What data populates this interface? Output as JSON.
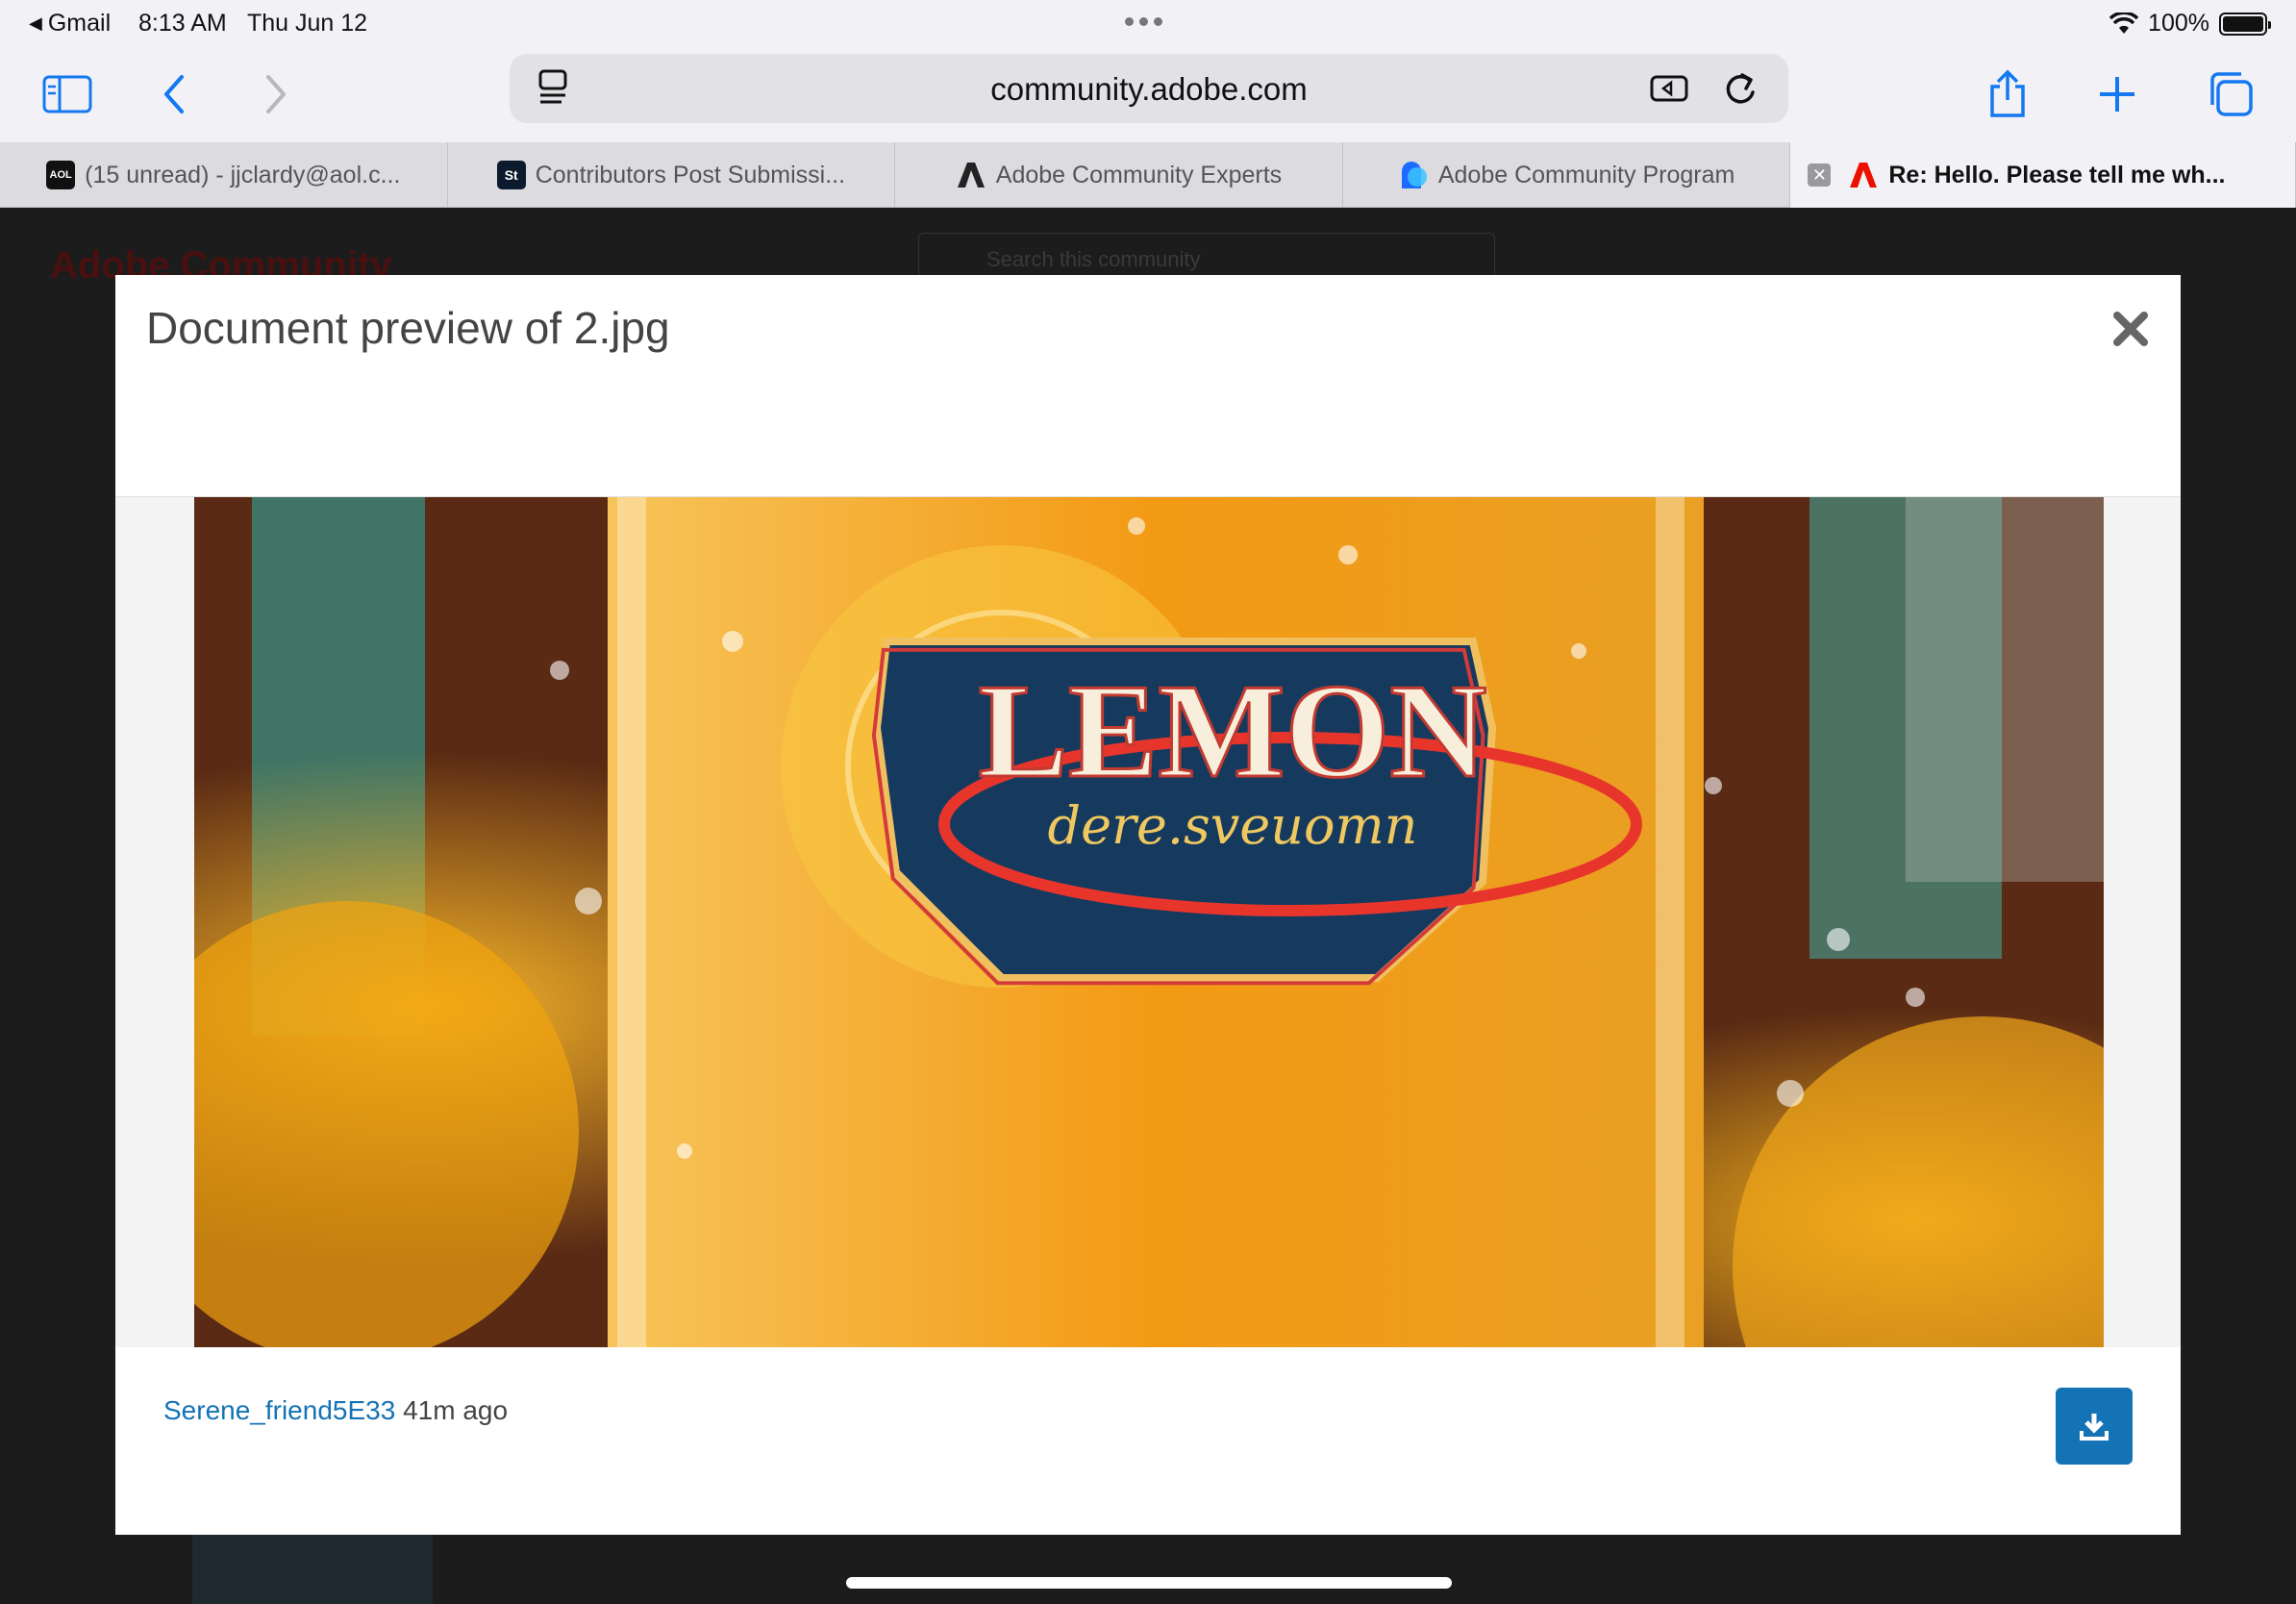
{
  "status_bar": {
    "back_app": "Gmail",
    "time": "8:13 AM",
    "date": "Thu Jun 12",
    "battery": "100%"
  },
  "browser": {
    "url": "community.adobe.com",
    "tabs": [
      {
        "label": "(15 unread) - jjclardy@aol.c...",
        "favicon": "AOL"
      },
      {
        "label": "Contributors Post Submissi...",
        "favicon": "St"
      },
      {
        "label": "Adobe Community Experts",
        "favicon": "adobe-icon"
      },
      {
        "label": "Adobe Community Program",
        "favicon": "community-icon"
      },
      {
        "label": "Re: Hello. Please tell me wh...",
        "favicon": "adobe-red-icon",
        "active": true
      }
    ]
  },
  "page": {
    "brand": "Adobe Community",
    "search_placeholder": "Search this community"
  },
  "modal": {
    "title": "Document preview of 2.jpg",
    "image_text_main": "LEMON",
    "image_text_script": "dere.sveuomn",
    "author": "Serene_friend5E33",
    "time_ago": "41m ago"
  },
  "colors": {
    "accent": "#1473b5",
    "adobe_red": "#eb1000"
  }
}
